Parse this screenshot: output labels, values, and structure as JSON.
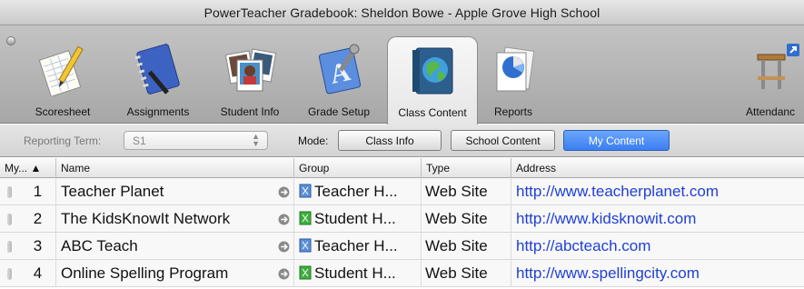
{
  "window": {
    "title": "PowerTeacher Gradebook: Sheldon Bowe - Apple Grove High School"
  },
  "toolbar": {
    "items": [
      {
        "label": "Scoresheet",
        "icon": "scoresheet-icon"
      },
      {
        "label": "Assignments",
        "icon": "assignments-notebook-icon"
      },
      {
        "label": "Student Info",
        "icon": "student-photos-icon"
      },
      {
        "label": "Grade Setup",
        "icon": "grade-setup-icon"
      },
      {
        "label": "Class Content",
        "icon": "class-content-globe-icon",
        "active": true
      },
      {
        "label": "Reports",
        "icon": "reports-pie-chart-icon"
      },
      {
        "label": "Attendanc",
        "icon": "attendance-desk-icon"
      }
    ]
  },
  "modebar": {
    "reporting_term_label": "Reporting Term:",
    "reporting_term_value": "S1",
    "mode_label": "Mode:",
    "buttons": [
      {
        "label": "Class Info"
      },
      {
        "label": "School Content"
      },
      {
        "label": "My Content",
        "selected": true
      }
    ]
  },
  "table": {
    "columns": [
      "My... ▲",
      "Name",
      "Group",
      "Type",
      "Address"
    ],
    "rows": [
      {
        "num": "1",
        "name": "Teacher Planet",
        "group": "Teacher H...",
        "group_color": "#5b8fd6",
        "type": "Web Site",
        "address": "http://www.teacherplanet.com"
      },
      {
        "num": "2",
        "name": "The KidsKnowIt Network",
        "group": "Student H...",
        "group_color": "#3fae3f",
        "type": "Web Site",
        "address": "http://www.kidsknowit.com"
      },
      {
        "num": "3",
        "name": "ABC Teach",
        "group": "Teacher H...",
        "group_color": "#5b8fd6",
        "type": "Web Site",
        "address": "http://abcteach.com"
      },
      {
        "num": "4",
        "name": "Online Spelling Program",
        "group": "Student H...",
        "group_color": "#3fae3f",
        "type": "Web Site",
        "address": "http://www.spellingcity.com"
      }
    ]
  },
  "colors": {
    "selected_button": "#3b7ef1",
    "link": "#1f3fd6"
  }
}
